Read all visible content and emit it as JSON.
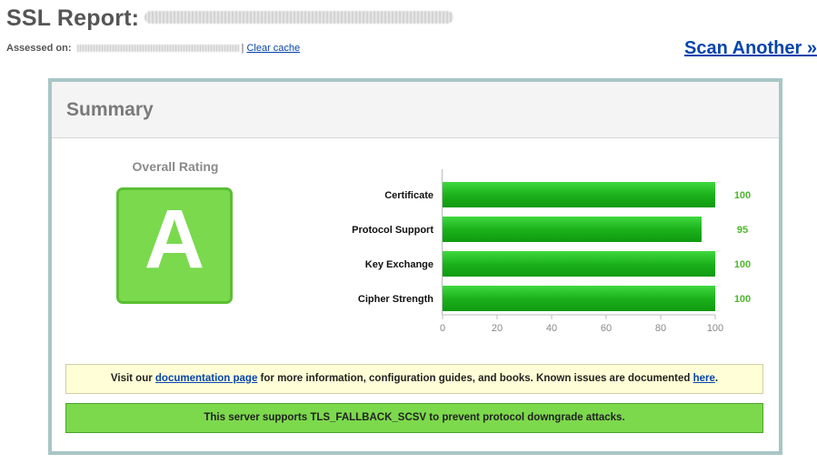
{
  "header": {
    "title": "SSL Report:",
    "assessed_label": "Assessed on:",
    "separator": "|",
    "clear_cache": "Clear cache",
    "scan_another": "Scan Another »"
  },
  "summary": {
    "heading": "Summary",
    "overall_label": "Overall Rating",
    "grade": "A",
    "grade_color": "#7ad94d"
  },
  "chart_data": {
    "type": "bar",
    "orientation": "horizontal",
    "categories": [
      "Certificate",
      "Protocol Support",
      "Key Exchange",
      "Cipher Strength"
    ],
    "values": [
      100,
      95,
      100,
      100
    ],
    "value_labels": [
      "100",
      "95",
      "100",
      "100"
    ],
    "xlim": [
      0,
      100
    ],
    "xticks": [
      0,
      20,
      40,
      60,
      80,
      100
    ],
    "grid": false,
    "bar_color": "#1cb21c",
    "value_color": "#4cb82c"
  },
  "notices": {
    "info": {
      "pre": "Visit our ",
      "doc_link": "documentation page",
      "mid": " for more information, configuration guides, and books. Known issues are documented ",
      "here_link": "here",
      "post": "."
    },
    "success": "This server supports TLS_FALLBACK_SCSV to prevent protocol downgrade attacks."
  }
}
